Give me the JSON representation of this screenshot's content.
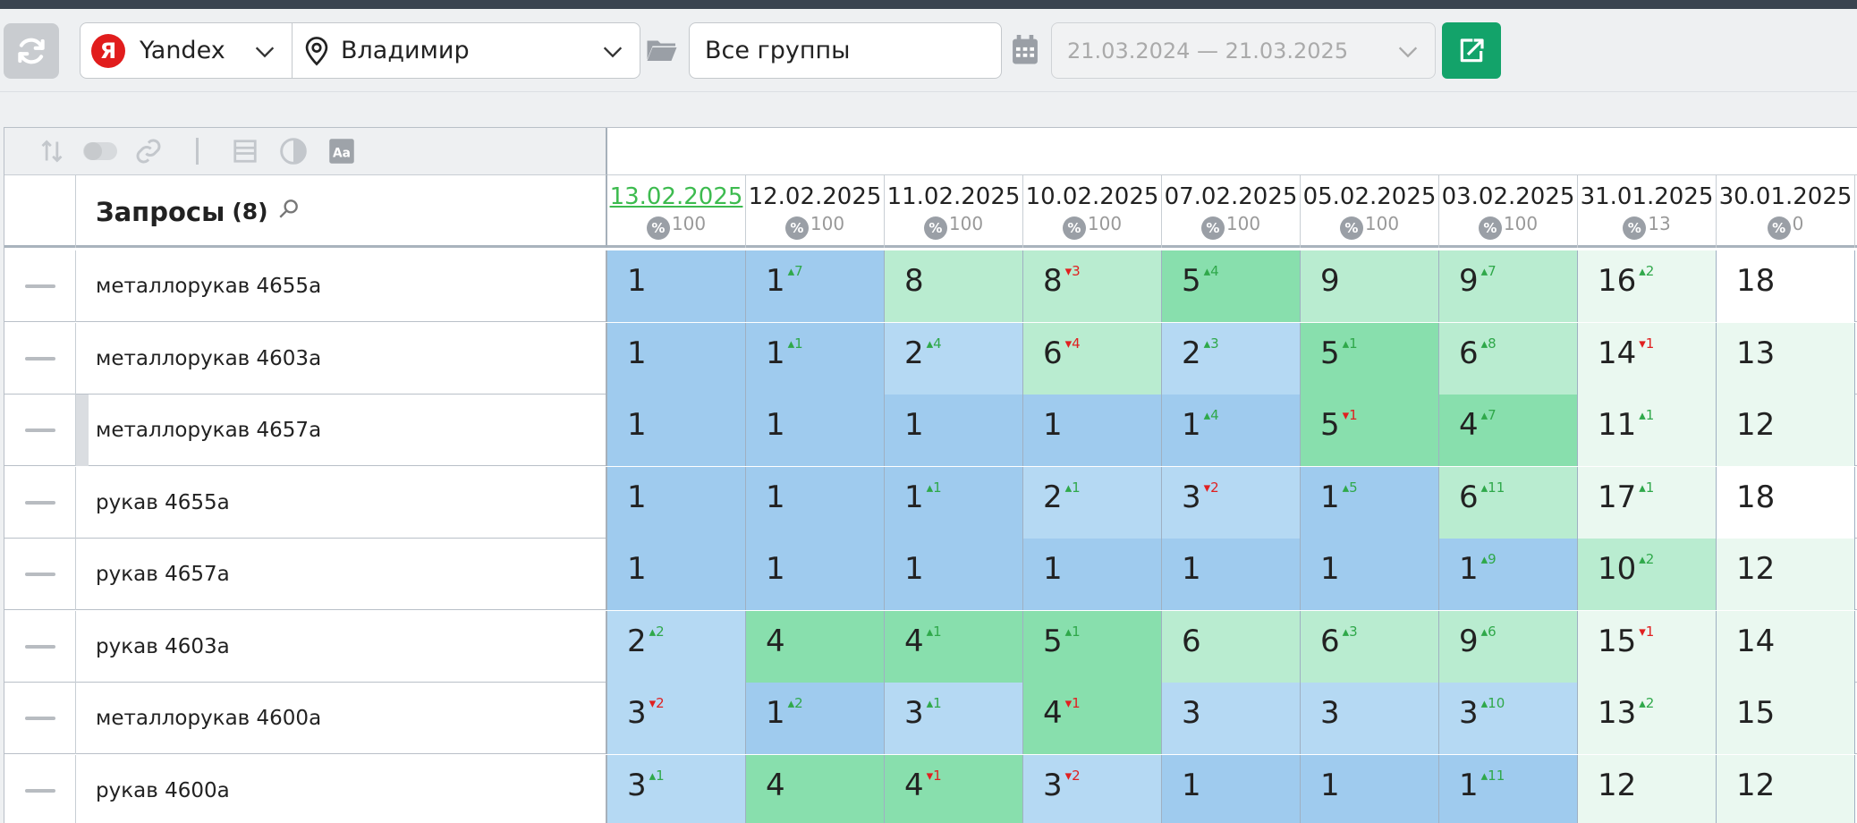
{
  "colors": {
    "top1": "#9fcbee",
    "top3": "#b5d9f3",
    "top5": "#88dfad",
    "top10": "#b9ecd0",
    "top20": "#eaf8f0",
    "out": "#ffffff",
    "up": "#2fa84a",
    "down": "#e02020",
    "export": "#13a36a"
  },
  "toolbar": {
    "engine_badge": "Я",
    "engine": "Yandex",
    "region": "Владимир",
    "groups": "Все группы",
    "date_range": "21.03.2024 — 21.03.2025",
    "icons": [
      "refresh-icon",
      "yandex-logo",
      "location-pin-icon",
      "folder-icon",
      "calendar-icon",
      "export-icon"
    ]
  },
  "table": {
    "query_header": "Запросы",
    "query_count": "(8)",
    "tools": [
      "sort-icon",
      "toggle-icon",
      "link-icon",
      "divider",
      "table-icon",
      "contrast-icon",
      "font-icon"
    ],
    "dates": [
      {
        "label": "13.02.2025",
        "pct": "100",
        "current": true
      },
      {
        "label": "12.02.2025",
        "pct": "100"
      },
      {
        "label": "11.02.2025",
        "pct": "100"
      },
      {
        "label": "10.02.2025",
        "pct": "100"
      },
      {
        "label": "07.02.2025",
        "pct": "100"
      },
      {
        "label": "05.02.2025",
        "pct": "100"
      },
      {
        "label": "03.02.2025",
        "pct": "100"
      },
      {
        "label": "31.01.2025",
        "pct": "13"
      },
      {
        "label": "30.01.2025",
        "pct": "0"
      }
    ],
    "rows": [
      {
        "query": "металлорукав 4655а",
        "marker": false,
        "cells": [
          {
            "v": "1",
            "d": ""
          },
          {
            "v": "1",
            "d": "7",
            "dir": "up"
          },
          {
            "v": "8",
            "d": ""
          },
          {
            "v": "8",
            "d": "3",
            "dir": "down"
          },
          {
            "v": "5",
            "d": "4",
            "dir": "up"
          },
          {
            "v": "9",
            "d": ""
          },
          {
            "v": "9",
            "d": "7",
            "dir": "up"
          },
          {
            "v": "16",
            "d": "2",
            "dir": "up"
          },
          {
            "v": "18",
            "d": ""
          }
        ]
      },
      {
        "query": "металлорукав 4603а",
        "marker": false,
        "cells": [
          {
            "v": "1",
            "d": ""
          },
          {
            "v": "1",
            "d": "1",
            "dir": "up"
          },
          {
            "v": "2",
            "d": "4",
            "dir": "up"
          },
          {
            "v": "6",
            "d": "4",
            "dir": "down"
          },
          {
            "v": "2",
            "d": "3",
            "dir": "up"
          },
          {
            "v": "5",
            "d": "1",
            "dir": "up"
          },
          {
            "v": "6",
            "d": "8",
            "dir": "up"
          },
          {
            "v": "14",
            "d": "1",
            "dir": "down"
          },
          {
            "v": "13",
            "d": ""
          }
        ]
      },
      {
        "query": "металлорукав 4657а",
        "marker": true,
        "cells": [
          {
            "v": "1",
            "d": ""
          },
          {
            "v": "1",
            "d": ""
          },
          {
            "v": "1",
            "d": ""
          },
          {
            "v": "1",
            "d": ""
          },
          {
            "v": "1",
            "d": "4",
            "dir": "up"
          },
          {
            "v": "5",
            "d": "1",
            "dir": "down"
          },
          {
            "v": "4",
            "d": "7",
            "dir": "up"
          },
          {
            "v": "11",
            "d": "1",
            "dir": "up"
          },
          {
            "v": "12",
            "d": ""
          }
        ]
      },
      {
        "query": "рукав 4655а",
        "marker": false,
        "cells": [
          {
            "v": "1",
            "d": ""
          },
          {
            "v": "1",
            "d": ""
          },
          {
            "v": "1",
            "d": "1",
            "dir": "up"
          },
          {
            "v": "2",
            "d": "1",
            "dir": "up"
          },
          {
            "v": "3",
            "d": "2",
            "dir": "down"
          },
          {
            "v": "1",
            "d": "5",
            "dir": "up"
          },
          {
            "v": "6",
            "d": "11",
            "dir": "up"
          },
          {
            "v": "17",
            "d": "1",
            "dir": "up"
          },
          {
            "v": "18",
            "d": ""
          }
        ]
      },
      {
        "query": "рукав 4657а",
        "marker": false,
        "cells": [
          {
            "v": "1",
            "d": ""
          },
          {
            "v": "1",
            "d": ""
          },
          {
            "v": "1",
            "d": ""
          },
          {
            "v": "1",
            "d": ""
          },
          {
            "v": "1",
            "d": ""
          },
          {
            "v": "1",
            "d": ""
          },
          {
            "v": "1",
            "d": "9",
            "dir": "up"
          },
          {
            "v": "10",
            "d": "2",
            "dir": "up"
          },
          {
            "v": "12",
            "d": ""
          }
        ]
      },
      {
        "query": "рукав 4603а",
        "marker": false,
        "cells": [
          {
            "v": "2",
            "d": "2",
            "dir": "up"
          },
          {
            "v": "4",
            "d": ""
          },
          {
            "v": "4",
            "d": "1",
            "dir": "up"
          },
          {
            "v": "5",
            "d": "1",
            "dir": "up"
          },
          {
            "v": "6",
            "d": ""
          },
          {
            "v": "6",
            "d": "3",
            "dir": "up"
          },
          {
            "v": "9",
            "d": "6",
            "dir": "up"
          },
          {
            "v": "15",
            "d": "1",
            "dir": "down"
          },
          {
            "v": "14",
            "d": ""
          }
        ]
      },
      {
        "query": "металлорукав 4600а",
        "marker": false,
        "cells": [
          {
            "v": "3",
            "d": "2",
            "dir": "down"
          },
          {
            "v": "1",
            "d": "2",
            "dir": "up"
          },
          {
            "v": "3",
            "d": "1",
            "dir": "up"
          },
          {
            "v": "4",
            "d": "1",
            "dir": "down"
          },
          {
            "v": "3",
            "d": ""
          },
          {
            "v": "3",
            "d": ""
          },
          {
            "v": "3",
            "d": "10",
            "dir": "up"
          },
          {
            "v": "13",
            "d": "2",
            "dir": "up"
          },
          {
            "v": "15",
            "d": ""
          }
        ]
      },
      {
        "query": "рукав 4600а",
        "marker": false,
        "cells": [
          {
            "v": "3",
            "d": "1",
            "dir": "up"
          },
          {
            "v": "4",
            "d": ""
          },
          {
            "v": "4",
            "d": "1",
            "dir": "down"
          },
          {
            "v": "3",
            "d": "2",
            "dir": "down"
          },
          {
            "v": "1",
            "d": ""
          },
          {
            "v": "1",
            "d": ""
          },
          {
            "v": "1",
            "d": "11",
            "dir": "up"
          },
          {
            "v": "12",
            "d": ""
          },
          {
            "v": "12",
            "d": ""
          }
        ]
      }
    ]
  }
}
